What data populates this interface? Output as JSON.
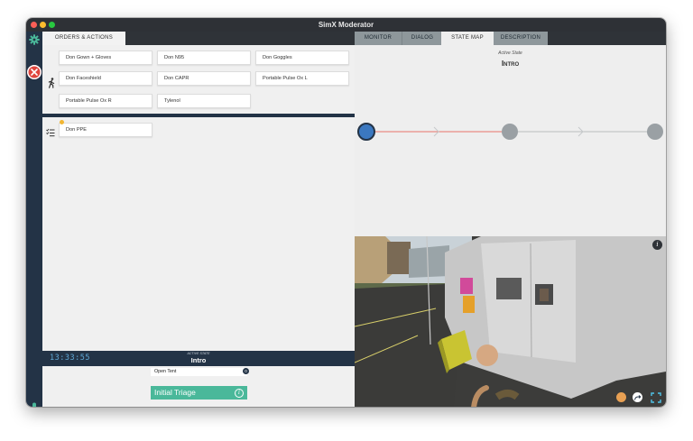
{
  "window": {
    "title": "SimX Moderator"
  },
  "left": {
    "tab_label": "ORDERS & ACTIONS",
    "orders": [
      "Don Gown + Gloves",
      "Don N95",
      "Don Goggles",
      "Don Faceshield",
      "Don CAPR",
      "Portable Pulse Ox L",
      "Portable Pulse Ox R",
      "Tylenol"
    ],
    "queued": [
      "Don PPE"
    ],
    "clock": "13:33:55",
    "active_state_caption": "Active State",
    "active_state": "Intro",
    "transition_label": "Open Tent",
    "transition_badge": "0",
    "next_state": "Initial Triage"
  },
  "right": {
    "tabs": [
      "MONITOR",
      "DIALOG",
      "STATE MAP",
      "DESCRIPTION"
    ],
    "selected_tab": "STATE MAP",
    "state_map": {
      "caption": "Active State",
      "title": "Intro",
      "node_count": 3,
      "active_index": 0
    }
  },
  "colors": {
    "accent_teal": "#4ab89a",
    "navy": "#233346",
    "active_node": "#3b78c0",
    "inactive_node": "#9aa0a4",
    "close_red": "#e0463e",
    "progress_red": "#e8746a"
  },
  "icons": [
    "gear-icon",
    "close-icon",
    "walking-person-icon",
    "checklist-icon",
    "microphone-icon",
    "info-icon",
    "recenter-icon",
    "fullscreen-icon"
  ]
}
